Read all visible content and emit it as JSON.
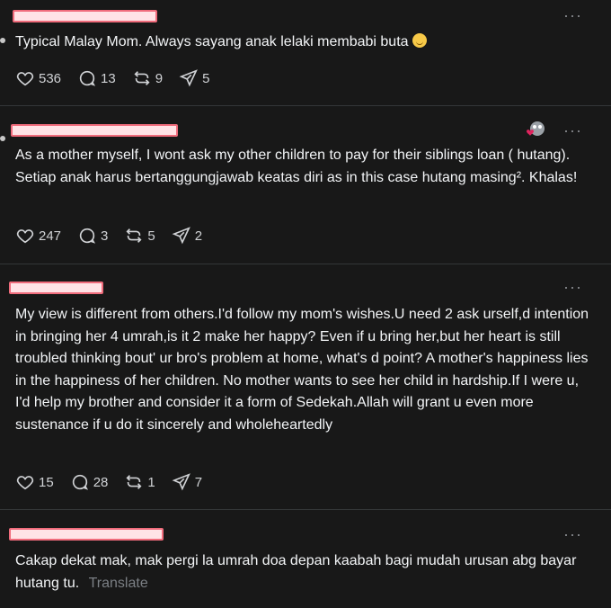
{
  "posts": [
    {
      "text": "Typical Malay Mom. Always sayang anak lelaki membabi buta",
      "likes": "536",
      "comments": "13",
      "reposts": "9",
      "shares": "5"
    },
    {
      "text": "As a mother myself, I wont ask my other children to pay for their siblings loan ( hutang). Setiap anak harus bertanggungjawab keatas diri as in this case hutang masing². Khalas!",
      "likes": "247",
      "comments": "3",
      "reposts": "5",
      "shares": "2"
    },
    {
      "text": "My view is different from others.I'd follow my mom's wishes.U need 2 ask urself,d intention in bringing her 4 umrah,is it 2 make her happy? Even if u bring her,but her heart is still troubled thinking bout' ur bro's problem at home, what's d point? A mother's happiness lies in the happiness of her children. No mother wants to see her child in hardship.If I were u, I'd help my brother and consider it a form of Sedekah.Allah will grant u even more sustenance if u do it sincerely and wholeheartedly",
      "likes": "15",
      "comments": "28",
      "reposts": "1",
      "shares": "7"
    },
    {
      "text": "Cakap dekat mak, mak pergi la umrah doa depan kaabah bagi mudah urusan abg bayar hutang tu.",
      "translate": "Translate"
    }
  ],
  "icons": {
    "like": "heart-icon",
    "comment": "comment-icon",
    "repost": "repost-icon",
    "share": "share-icon",
    "more": "more-icon"
  },
  "colors": {
    "background": "#181818",
    "text": "#f3f5f7",
    "muted": "#7b7f84",
    "redaction_fill": "#ffe3e6",
    "redaction_border": "#f06c7c"
  }
}
